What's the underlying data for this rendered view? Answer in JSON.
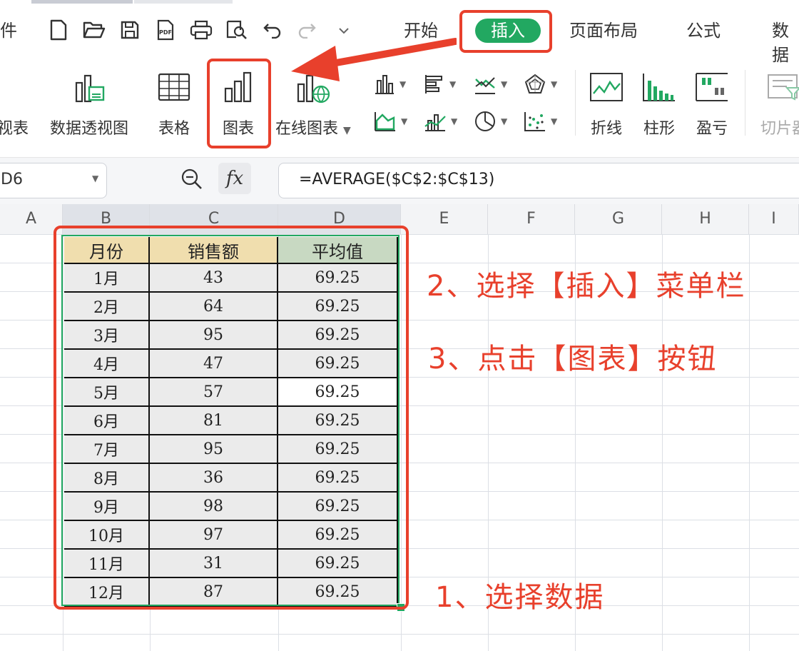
{
  "toolbar": {
    "file_tab_partial": "件",
    "menu_tabs": [
      "开始",
      "插入",
      "页面布局",
      "公式",
      "数据"
    ],
    "active_tab": "插入",
    "ribbon": {
      "pivot_chart_partial": "视表",
      "pivot_view": "数据透视图",
      "table": "表格",
      "chart": "图表",
      "online_chart": "在线图表",
      "sparkline_line": "折线",
      "sparkline_column": "柱形",
      "sparkline_winloss": "盈亏",
      "slicer_partial": "切片器"
    }
  },
  "formula_bar": {
    "name_box": "D6",
    "fx": "fx",
    "formula": "=AVERAGE($C$2:$C$13)"
  },
  "columns": [
    "A",
    "B",
    "C",
    "D",
    "E",
    "F",
    "G",
    "H",
    "I"
  ],
  "table": {
    "headers": [
      "月份",
      "销售额",
      "平均值"
    ],
    "rows": [
      [
        "1月",
        "43",
        "69.25"
      ],
      [
        "2月",
        "64",
        "69.25"
      ],
      [
        "3月",
        "95",
        "69.25"
      ],
      [
        "4月",
        "47",
        "69.25"
      ],
      [
        "5月",
        "57",
        "69.25"
      ],
      [
        "6月",
        "81",
        "69.25"
      ],
      [
        "7月",
        "95",
        "69.25"
      ],
      [
        "8月",
        "36",
        "69.25"
      ],
      [
        "9月",
        "98",
        "69.25"
      ],
      [
        "10月",
        "97",
        "69.25"
      ],
      [
        "11月",
        "31",
        "69.25"
      ],
      [
        "12月",
        "87",
        "69.25"
      ]
    ]
  },
  "annotations": {
    "step1": "1、选择数据",
    "step2": "2、选择【插入】菜单栏",
    "step3": "3、点击【图表】按钮"
  },
  "colors": {
    "accent_green": "#22a861",
    "annotation_red": "#e8402c",
    "header_tan": "#f0deae",
    "header_green": "#c8d9c2",
    "cell_gray": "#ebebeb"
  }
}
